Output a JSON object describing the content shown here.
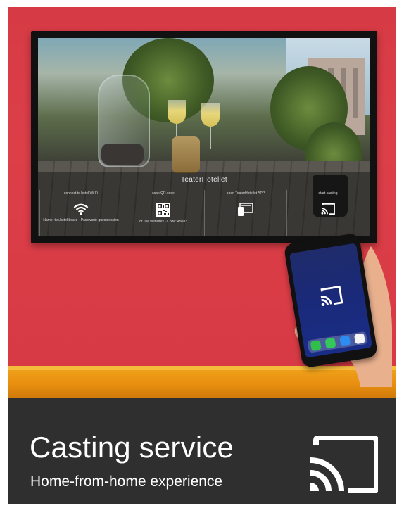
{
  "tv": {
    "title": "TeaterHotellet",
    "tiles": [
      {
        "heading": "connect to hotel Wi-Fi",
        "footer": "Name: tvs.hotel.board · Password: guestsession",
        "icon": "wifi-icon"
      },
      {
        "heading": "scan QR code",
        "footer": "or use websites · Code: 45083",
        "icon": "qr-code-icon"
      },
      {
        "heading": "open TeaterHotellet APP",
        "footer": "",
        "icon": "app-icon"
      },
      {
        "heading": "start casting",
        "footer": "",
        "icon": "cast-icon"
      }
    ]
  },
  "banner": {
    "title": "Casting service",
    "subtitle": "Home-from-home experience",
    "icon": "cast-icon"
  },
  "colors": {
    "wall": "#d63a44",
    "shelf": "#ec9612",
    "banner": "#2f2f2f",
    "text": "#ffffff"
  }
}
